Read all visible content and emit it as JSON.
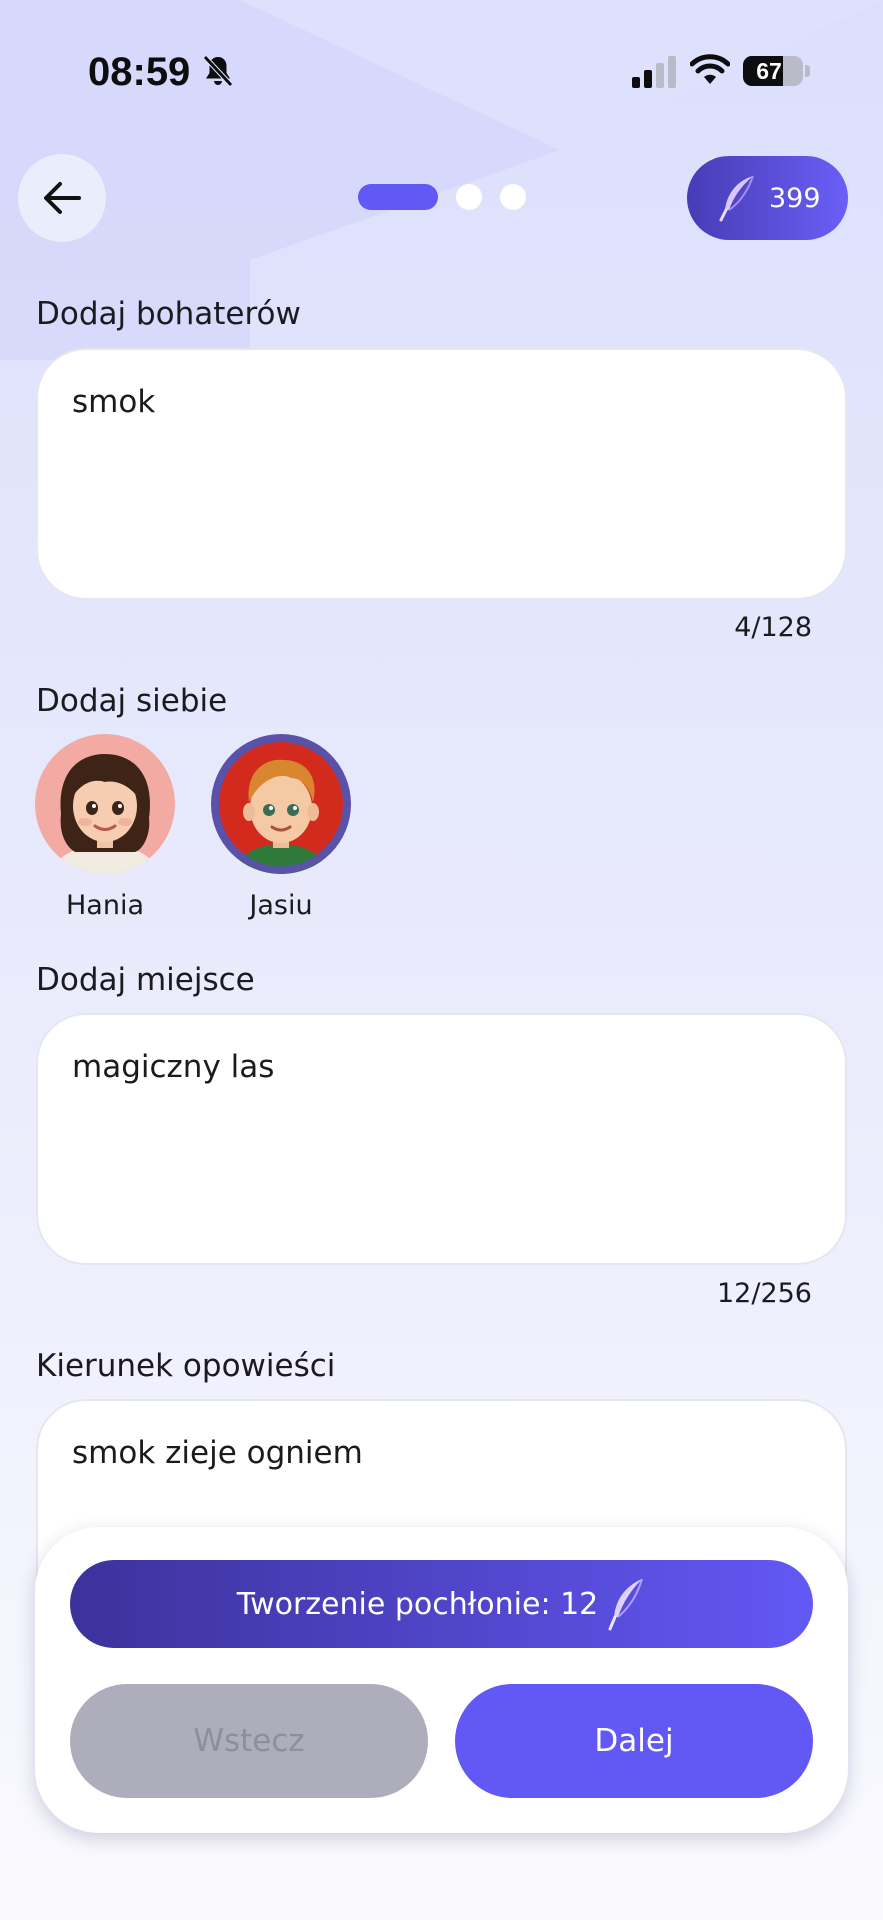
{
  "status_bar": {
    "time": "08:59",
    "battery": "67",
    "battery_level": 0.67
  },
  "header": {
    "credits": "399",
    "steps_total": 3,
    "step_active": 1
  },
  "heroes": {
    "label": "Dodaj bohaterów",
    "value": "smok",
    "counter": "4/128"
  },
  "self": {
    "label": "Dodaj siebie",
    "avatars": [
      {
        "name": "Hania",
        "selected": false
      },
      {
        "name": "Jasiu",
        "selected": true
      }
    ]
  },
  "place": {
    "label": "Dodaj miejsce",
    "value": "magiczny las",
    "counter": "12/256"
  },
  "direction": {
    "label": "Kierunek opowieści",
    "value": "smok zieje ogniem"
  },
  "footer": {
    "cost_label": "Tworzenie pochłonie: 12",
    "back_label": "Wstecz",
    "next_label": "Dalej"
  },
  "colors": {
    "accent": "#6258f5",
    "accent_dark": "#3c329b",
    "disabled": "#aeadbb"
  },
  "icons": [
    "bell-slash-icon",
    "signal-icon",
    "wifi-icon",
    "battery-icon",
    "back-arrow-icon",
    "feather-icon"
  ]
}
